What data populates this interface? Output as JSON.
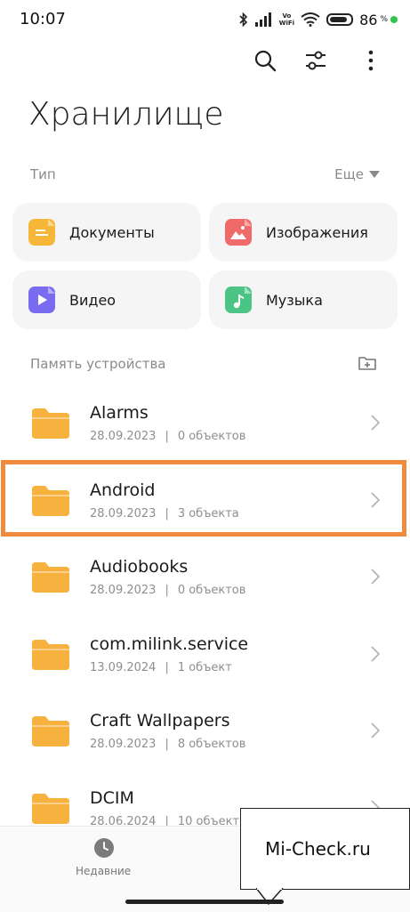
{
  "status": {
    "time": "10:07",
    "vowifi_top": "Vo",
    "vowifi_bottom": "WiFi",
    "battery": "86",
    "battery_unit": "%",
    "battery_level": 0.86
  },
  "header": {
    "title": "Хранилище"
  },
  "types": {
    "label": "Тип",
    "more_label": "Еще",
    "items": [
      {
        "label": "Документы",
        "icon": "document-icon",
        "color": "#f6b638"
      },
      {
        "label": "Изображения",
        "icon": "image-icon",
        "color": "#f06a6a"
      },
      {
        "label": "Видео",
        "icon": "video-icon",
        "color": "#7a6cf0"
      },
      {
        "label": "Музыка",
        "icon": "music-icon",
        "color": "#4cc486"
      }
    ]
  },
  "storage": {
    "label": "Память устройства",
    "folders": [
      {
        "name": "Alarms",
        "date": "28.09.2023",
        "sep": "|",
        "count": "0 объектов"
      },
      {
        "name": "Android",
        "date": "28.09.2023",
        "sep": "|",
        "count": "3 объекта"
      },
      {
        "name": "Audiobooks",
        "date": "28.09.2023",
        "sep": "|",
        "count": "0 объектов"
      },
      {
        "name": "com.milink.service",
        "date": "13.09.2024",
        "sep": "|",
        "count": "1 объект"
      },
      {
        "name": "Craft Wallpapers",
        "date": "28.09.2023",
        "sep": "|",
        "count": "8 объектов"
      },
      {
        "name": "DCIM",
        "date": "28.06.2024",
        "sep": "|",
        "count": "10 объектов"
      }
    ]
  },
  "bottom_nav": {
    "recent_label": "Недавние"
  },
  "watermark": {
    "text": "Mi-Check.ru"
  },
  "colors": {
    "folder": "#f7b13f",
    "highlight": "#f08a3c"
  }
}
